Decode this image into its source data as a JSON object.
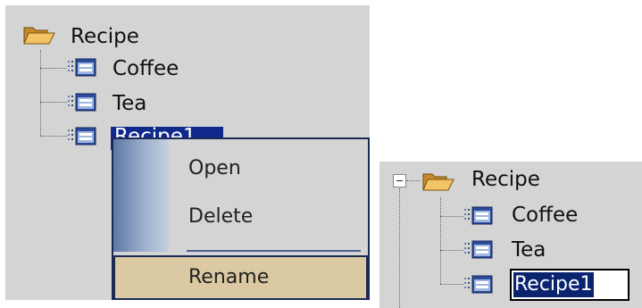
{
  "left_tree": {
    "root_label": "Recipe",
    "children": [
      "Coffee",
      "Tea",
      "Recipe1"
    ]
  },
  "context_menu": {
    "items": [
      "Open",
      "Delete",
      "Rename"
    ],
    "highlighted": "Rename"
  },
  "right_tree": {
    "root_label": "Recipe",
    "children": [
      "Coffee",
      "Tea"
    ],
    "edit_value": "Recipe1"
  },
  "colors": {
    "panel_bg": "#d4d4d4",
    "selection": "#0f2a8c",
    "menu_border": "#1b2a55",
    "menu_highlight": "#dac9a2",
    "gutter": "#7f96bb",
    "folder": "#e8b04a"
  },
  "icons": {
    "folder": "open-folder-icon",
    "item": "table-icon",
    "expander": "collapse-box-icon"
  }
}
